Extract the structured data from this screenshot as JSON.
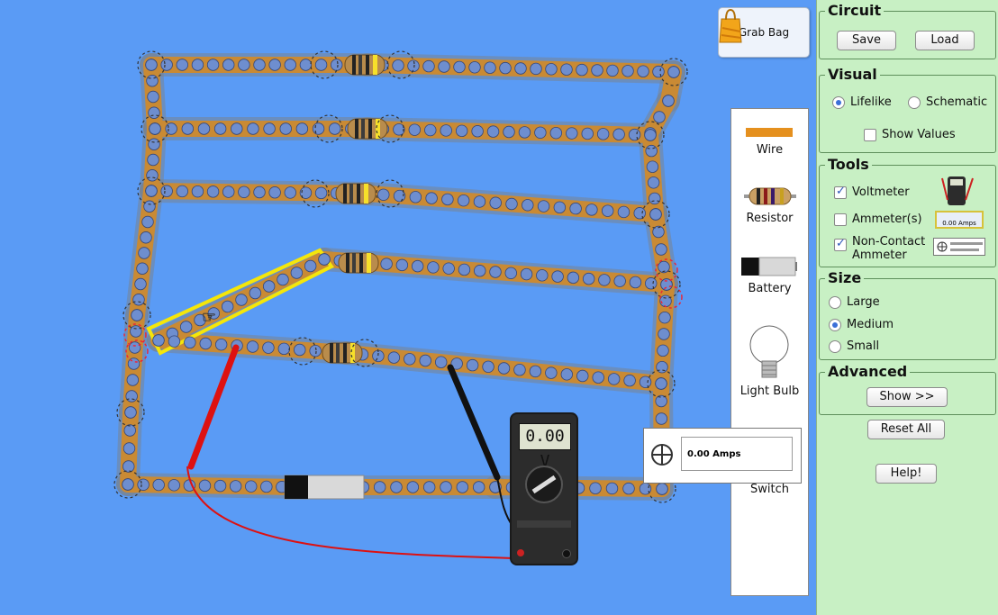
{
  "grab_bag": {
    "label": "Grab Bag",
    "icon": "shopping-bag-icon"
  },
  "toolbox": {
    "wire": "Wire",
    "resistor": "Resistor",
    "battery": "Battery",
    "light_bulb": "Light Bulb",
    "switch": "Switch"
  },
  "voltmeter_display": "0.00 V",
  "noncontact_readout": "0.00 Amps",
  "panel": {
    "circuit": {
      "title": "Circuit",
      "save": "Save",
      "load": "Load"
    },
    "visual": {
      "title": "Visual",
      "lifelike": "Lifelike",
      "schematic": "Schematic",
      "selected": "Lifelike",
      "show_values": "Show Values",
      "show_values_checked": false
    },
    "tools": {
      "title": "Tools",
      "voltmeter": "Voltmeter",
      "voltmeter_checked": true,
      "ammeters": "Ammeter(s)",
      "ammeters_checked": false,
      "noncontact_1": "Non-Contact",
      "noncontact_2": "Ammeter",
      "noncontact_checked": true,
      "ammeter_thumb": "0.00 Amps"
    },
    "size": {
      "title": "Size",
      "large": "Large",
      "medium": "Medium",
      "small": "Small",
      "selected": "Medium"
    },
    "advanced": {
      "title": "Advanced",
      "show": "Show >>"
    },
    "reset_all": "Reset All",
    "help": "Help!"
  },
  "colors": {
    "background": "#5a9bf5",
    "wire": "#c98a34",
    "electron": "#6e8ecf",
    "panel": "#c8f0c4",
    "selection": "#f5e60a"
  }
}
